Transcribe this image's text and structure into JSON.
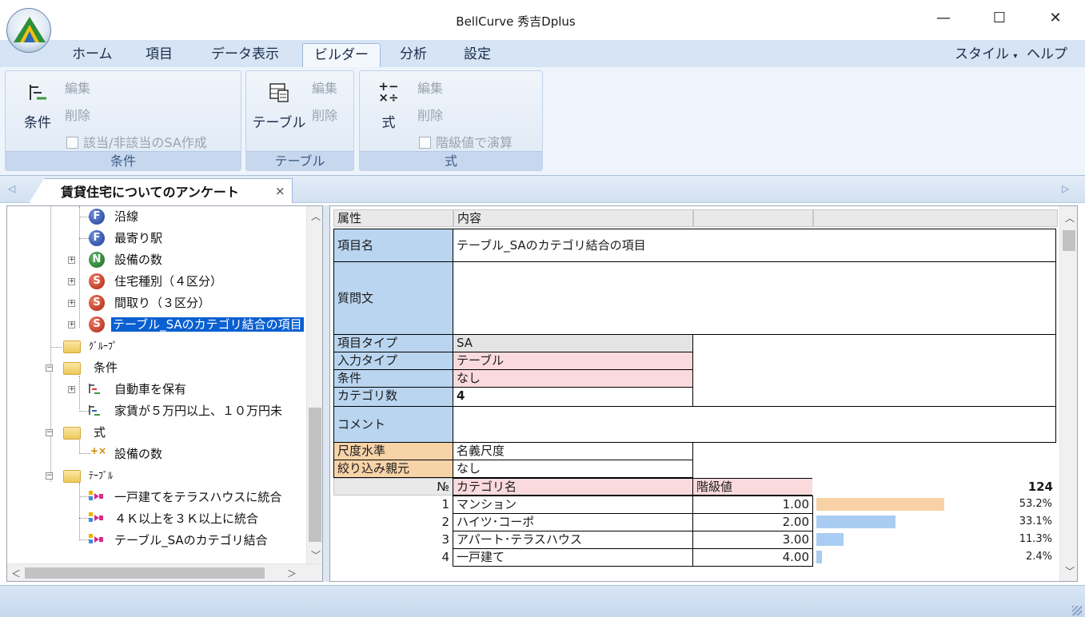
{
  "window": {
    "title": "BellCurve 秀吉Dplus",
    "minimize": "—",
    "maximize": "☐",
    "close": "✕"
  },
  "ribbon": {
    "tabs": [
      "ホーム",
      "項目",
      "データ表示",
      "ビルダー",
      "分析",
      "設定"
    ],
    "active_tab": "ビルダー",
    "right_menus": [
      "スタイル",
      "ヘルプ"
    ],
    "groups": {
      "condition": {
        "label": "条件",
        "big_button": "条件",
        "edit": "編集",
        "delete": "削除",
        "checkbox": "該当/非該当のSA作成"
      },
      "table": {
        "label": "テーブル",
        "big_button": "テーブル",
        "edit": "編集",
        "delete": "削除"
      },
      "formula": {
        "label": "式",
        "big_button": "式",
        "edit": "編集",
        "delete": "削除",
        "checkbox": "階級値で演算"
      }
    }
  },
  "document_tab": {
    "title": "賃貸住宅についてのアンケート",
    "close": "×"
  },
  "tree": {
    "items": [
      {
        "label": "沿線",
        "badge": "F"
      },
      {
        "label": "最寄り駅",
        "badge": "F"
      },
      {
        "label": "設備の数",
        "badge": "N"
      },
      {
        "label": "住宅種別（４区分）",
        "badge": "S"
      },
      {
        "label": "間取り（３区分）",
        "badge": "S"
      },
      {
        "label": "テーブル_SAのカテゴリ結合の項目",
        "badge": "S"
      },
      {
        "label": "ｸﾞﾙｰﾌﾟ"
      },
      {
        "label": "条件"
      },
      {
        "label": "自動車を保有"
      },
      {
        "label": "家賃が５万円以上、１０万円未"
      },
      {
        "label": "式"
      },
      {
        "label": "設備の数"
      },
      {
        "label": "ﾃｰﾌﾞﾙ"
      },
      {
        "label": "一戸建てをテラスハウスに統合"
      },
      {
        "label": "４Ｋ以上を３Ｋ以上に統合"
      },
      {
        "label": "テーブル_SAのカテゴリ結合"
      }
    ]
  },
  "grid": {
    "header": {
      "attr": "属性",
      "content": "内容"
    },
    "item_name": {
      "label": "項目名",
      "value": "テーブル_SAのカテゴリ結合の項目"
    },
    "question": {
      "label": "質問文",
      "value": ""
    },
    "item_type": {
      "label": "項目タイプ",
      "value": "SA"
    },
    "input_type": {
      "label": "入力タイプ",
      "value": "テーブル"
    },
    "condition": {
      "label": "条件",
      "value": "なし"
    },
    "category_count": {
      "label": "カテゴリ数",
      "value": "4"
    },
    "comment": {
      "label": "コメント",
      "value": ""
    },
    "scale": {
      "label": "尺度水準",
      "value": "名義尺度"
    },
    "filter_parent": {
      "label": "絞り込み親元",
      "value": "なし"
    },
    "cat_header": {
      "no": "№",
      "name": "カテゴリ名",
      "class_value": "階級値",
      "total": "124"
    },
    "categories": [
      {
        "no": "1",
        "name": "マンション",
        "class_value": "1.00",
        "pct": "53.2%",
        "ratio": 0.532,
        "color": "#f8d1a6"
      },
      {
        "no": "2",
        "name": "ハイツ･コーポ",
        "class_value": "2.00",
        "pct": "33.1%",
        "ratio": 0.331,
        "color": "#a9cdf2"
      },
      {
        "no": "3",
        "name": "アパート･テラスハウス",
        "class_value": "3.00",
        "pct": "11.3%",
        "ratio": 0.113,
        "color": "#a9cdf2"
      },
      {
        "no": "4",
        "name": "一戸建て",
        "class_value": "4.00",
        "pct": "2.4%",
        "ratio": 0.024,
        "color": "#a9cdf2"
      }
    ]
  }
}
